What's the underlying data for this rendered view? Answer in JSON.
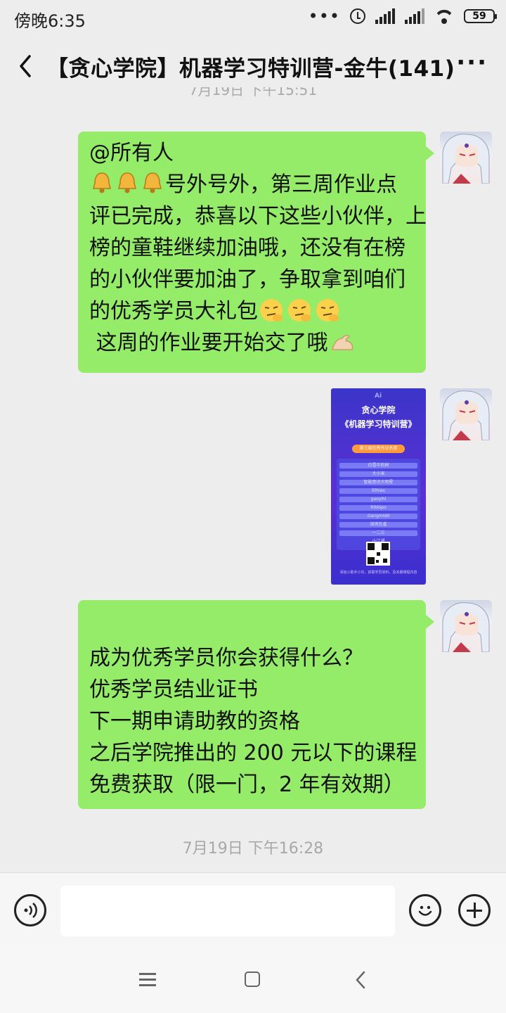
{
  "status_bar": {
    "time": "傍晚6:35",
    "battery": "59"
  },
  "header": {
    "title": "【贪心学院】机器学习特训营-金牛(141)",
    "more_label": "···"
  },
  "partial_timestamp": "7月19日 下午15:51",
  "messages": [
    {
      "lines": [
        "@所有人",
        "号外号外，第三周作业点",
        "评已完成，恭喜以下这些小伙伴，上",
        "榜的童鞋继续加油哦，还没有在榜",
        "的小伙伴要加油了，争取拿到咱们",
        "的优秀学员大礼包",
        "这周的作业要开始交了哦"
      ]
    },
    {
      "image": {
        "logo": "Ai",
        "title1": "贪心学院",
        "title2": "《机器学习特训营》",
        "badge": "第三周优秀作业名单",
        "names": [
          "白雪中的树",
          "大小米",
          "智能意识大明星",
          "Ethias",
          "gaoyihi",
          "Ribbipo",
          "Gangmidd",
          "深圳孔雀",
          "一二三",
          "小江湖"
        ],
        "footer": "添加小助手小灰，获取学员资料，及本期课程内容"
      }
    },
    {
      "lines": [
        "成为优秀学员你会获得什么？",
        "优秀学员结业证书",
        "下一期申请助教的资格",
        "之后学院推出的 200 元以下的课程",
        "免费获取（限一门，2 年有效期）"
      ]
    }
  ],
  "timestamp": "7月19日 下午16:28",
  "colors": {
    "bubble": "#95ec69",
    "background": "#ededed"
  }
}
